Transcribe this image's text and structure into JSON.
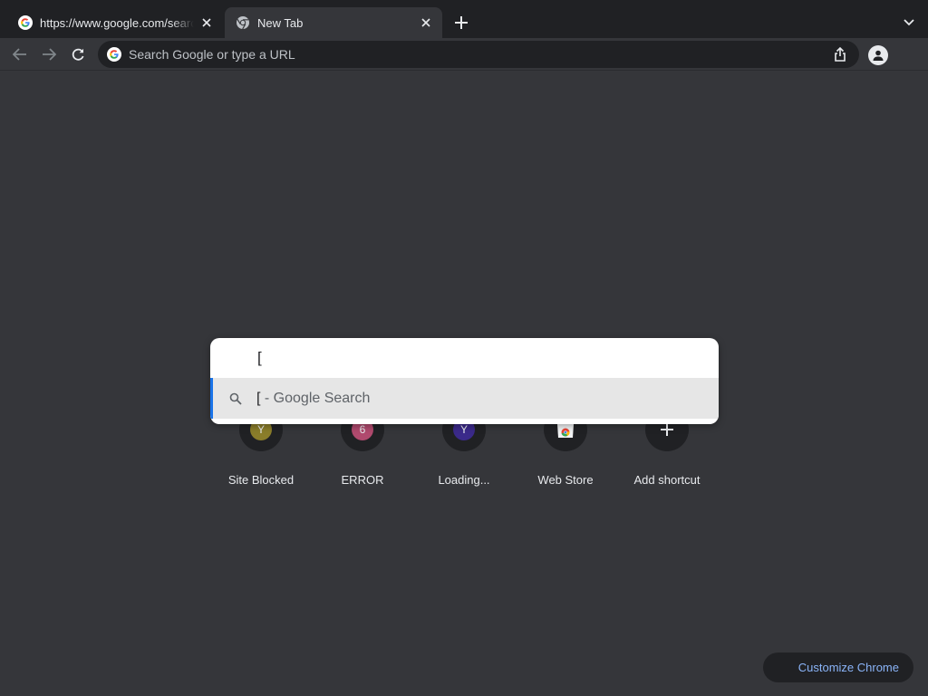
{
  "tabs": [
    {
      "title": "https://www.google.com/search",
      "favicon": "google-g-icon",
      "active": false
    },
    {
      "title": "New Tab",
      "favicon": "chrome-icon",
      "active": true
    }
  ],
  "omnibox": {
    "placeholder": "Search Google or type a URL"
  },
  "search_popup": {
    "query": "[",
    "suggestions": [
      {
        "text": "[",
        "suffix": " - Google Search",
        "icon": "search-icon"
      }
    ]
  },
  "shortcuts": [
    {
      "label": "Site Blocked",
      "badge": "Y",
      "badge_color": "#8a7d2a"
    },
    {
      "label": "ERROR",
      "badge": "6",
      "badge_color": "#b04a6e"
    },
    {
      "label": "Loading...",
      "badge": "Y",
      "badge_color": "#3b2a8a"
    },
    {
      "label": "Web Store",
      "badge": "",
      "icon": "web-store-icon"
    },
    {
      "label": "Add shortcut",
      "badge": "",
      "icon": "plus-icon"
    }
  ],
  "customize_button": {
    "label": "Customize Chrome"
  },
  "colors": {
    "frame": "#202124",
    "toolbar": "#35363a",
    "accent": "#8ab4f8",
    "focus": "#1a73e8"
  }
}
